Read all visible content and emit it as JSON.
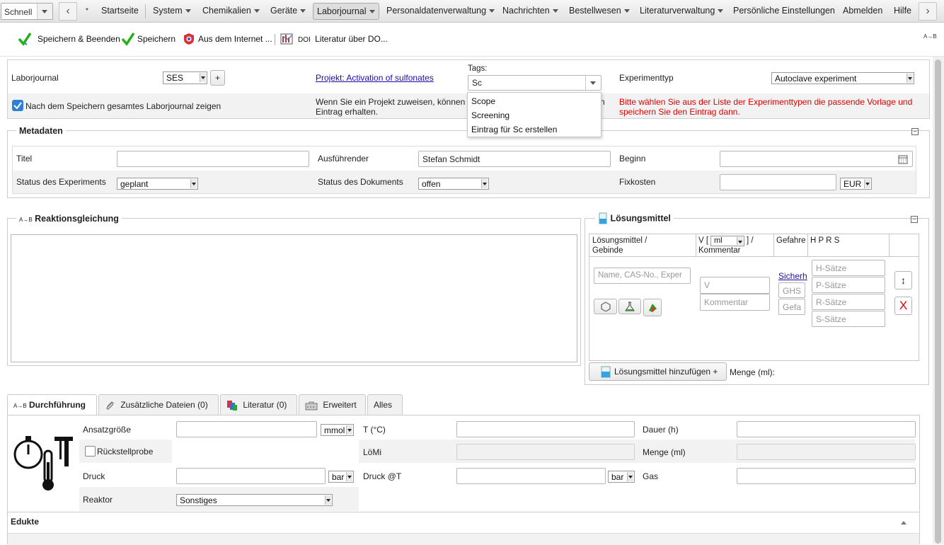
{
  "nav": {
    "quick": "Schnell",
    "star": "*",
    "items": [
      "Startseite",
      "System",
      "Chemikalien",
      "Geräte",
      "Laborjournal",
      "Personaldatenverwaltung",
      "Nachrichten",
      "Bestellwesen",
      "Literaturverwaltung",
      "Persönliche Einstellungen",
      "Abmelden",
      "Hilfe"
    ]
  },
  "toolbar": {
    "save_close": "Speichern & Beenden",
    "save": "Speichern",
    "internet": "Aus dem Internet ...",
    "doi_label": "DOI",
    "literatur": "Literatur über DO...",
    "ab_icon": "A→B"
  },
  "header": {
    "laborjournal_label": "Laborjournal",
    "laborjournal_value": "SES",
    "plus": "+",
    "project_link": "Projekt: Activation of sulfonates",
    "tags_label": "Tags:",
    "tags_value": "Sc",
    "exptype_label": "Experimenttyp",
    "exptype_value": "Autoclave experiment",
    "show_label": "Nach dem Speichern gesamtes Laborjournal zeigen",
    "project_hint": "Wenn Sie ein Projekt zuweisen, können Sie ... Eintrag erhalten.",
    "project_hint_l1": "Wenn Sie ein Projekt zuweisen, können",
    "project_hint_l2": "Eintrag erhalten.",
    "project_hint_tail": "n",
    "exptype_hint_l1": "Bitte wählen Sie aus der Liste der Experimenttypen die passende Vorlage und",
    "exptype_hint_l2": "speichern Sie den Eintrag dann."
  },
  "tag_suggestions": [
    "Scope",
    "Screening",
    "Eintrag für Sc erstellen"
  ],
  "metadaten": {
    "legend": "Metadaten",
    "titel_label": "Titel",
    "titel_value": "",
    "ausfuehrender_label": "Ausführender",
    "ausfuehrender_value": "Stefan Schmidt",
    "beginn_label": "Beginn",
    "status_exp_label": "Status des Experiments",
    "status_exp_value": "geplant",
    "status_doc_label": "Status des Dokuments",
    "status_doc_value": "offen",
    "fixkosten_label": "Fixkosten",
    "currency": "EUR"
  },
  "reaktion": {
    "legend": "Reaktionsgleichung",
    "icon_text": "A→B"
  },
  "loesungsmittel": {
    "legend": "Lösungsmittel",
    "col1_l1": "Lösungsmittel /",
    "col1_l2": "Gebinde",
    "col2_pre": "V [",
    "col2_unit": "ml",
    "col2_post": "] /",
    "col2_l2": "Kommentar",
    "col3": "Gefahre",
    "col4": "H P R S",
    "name_placeholder": "Name, CAS-No., Exper",
    "v_placeholder": "V",
    "kommentar_placeholder": "Kommentar",
    "sicherheit_link": "Sicherh",
    "ghs_placeholder": "GHS",
    "gefa_placeholder": "Gefa",
    "h_placeholder": "H-Sätze",
    "p_placeholder": "P-Sätze",
    "r_placeholder": "R-Sätze",
    "s_placeholder": "S-Sätze",
    "add_button": "Lösungsmittel hinzufügen +",
    "menge_label": "Menge (ml):",
    "delete_x": "X",
    "sort_arrow": "↕"
  },
  "tabs": [
    "Durchführung",
    "Zusätzliche Dateien (0)",
    "Literatur (0)",
    "Erweitert",
    "Alles"
  ],
  "tab_icon_text": "A→B",
  "durchfuehrung": {
    "ansatz_label": "Ansatzgröße",
    "ansatz_unit": "mmol",
    "rueckstell_label": "Rückstellprobe",
    "druck_label": "Druck",
    "druck_unit": "bar",
    "reaktor_label": "Reaktor",
    "reaktor_value": "Sonstiges",
    "t_label": "T (°C)",
    "loemi_label": "LöMi",
    "druck_t_label": "Druck @T",
    "druck_t_unit": "bar",
    "dauer_label": "Dauer (h)",
    "menge_label": "Menge (ml)",
    "gas_label": "Gas"
  },
  "edukte": {
    "label": "Edukte"
  },
  "colors": {
    "link": "#1a0dab",
    "hint_red": "#e00000",
    "check_green": "#21b21a",
    "checkbox_blue": "#2f7fd6"
  }
}
